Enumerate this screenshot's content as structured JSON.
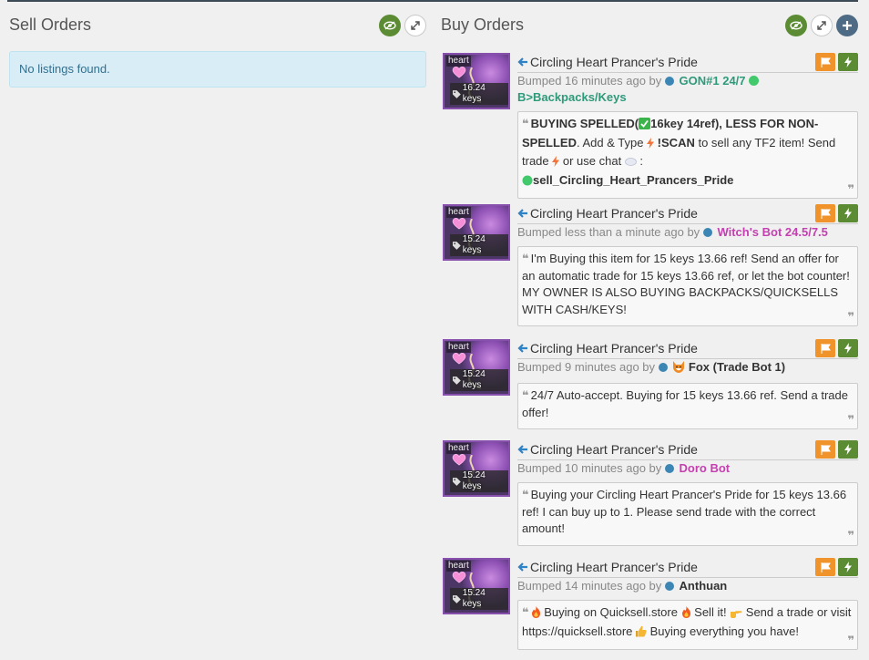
{
  "sell": {
    "title": "Sell Orders",
    "empty_text": "No listings found."
  },
  "buy": {
    "title": "Buy Orders"
  },
  "icons": {
    "visibility": "eye-icon",
    "expand": "expand-icon",
    "add": "plus-icon",
    "report": "flag-icon",
    "trade": "lightning-icon",
    "back": "arrow-left-icon",
    "price": "tag-icon"
  },
  "colors": {
    "green": "#5b8c33",
    "orange": "#f0932a",
    "item_border": "#8650ac",
    "notice_bg": "#d9edf7"
  },
  "listings": [
    {
      "effect": "heart",
      "price": "16.24 keys",
      "item_name": "Circling Heart Prancer's Pride",
      "bumped": "Bumped 16 minutes ago by",
      "user": "GON#1 24/7",
      "user_suffix": "B>Backpacks/Keys",
      "message": {
        "p1": "BUYING SPELLED(",
        "p2": "16key 14ref",
        "p3": "), LESS FOR NON-SPELLED",
        "p4": ". Add & Type ",
        "p5": " !SCAN",
        "p6": " to sell any TF2 item! Send trade ",
        "p7": " or  use  chat ",
        "p8": " :",
        "p9": "sell_Circling_Heart_Prancers_Pride"
      }
    },
    {
      "effect": "heart",
      "price": "15.24 keys",
      "item_name": "Circling Heart Prancer's Pride",
      "bumped": "Bumped less than a minute ago by",
      "user": "Witch's Bot 24.5/7.5",
      "message_text": "I'm Buying this item for 15 keys 13.66 ref! Send an offer for an automatic trade for 15 keys 13.66 ref, or let the bot counter! MY OWNER IS ALSO BUYING BACKPACKS/QUICKSELLS WITH CASH/KEYS!"
    },
    {
      "effect": "heart",
      "price": "15.24 keys",
      "item_name": "Circling Heart Prancer's Pride",
      "bumped": "Bumped 9 minutes ago by",
      "user": "Fox (Trade Bot 1)",
      "message_text": "24/7 Auto-accept. Buying for 15 keys 13.66 ref. Send a trade offer!"
    },
    {
      "effect": "heart",
      "price": "15.24 keys",
      "item_name": "Circling Heart Prancer's Pride",
      "bumped": "Bumped 10 minutes ago by",
      "user": "Doro Bot",
      "message_text": "Buying your Circling Heart Prancer's Pride for 15 keys 13.66 ref! I can buy up to 1. Please send trade with the correct amount!"
    },
    {
      "effect": "heart",
      "price": "15.24 keys",
      "item_name": "Circling Heart Prancer's Pride",
      "bumped": "Bumped 14 minutes ago by",
      "user": "Anthuan",
      "message": {
        "p1": " Buying on Quicksell.store ",
        "p2": "  Sell it! ",
        "p3": "  Send a trade or visit https://quicksell.store ",
        "p4": "  Buying everything you have!"
      }
    }
  ]
}
